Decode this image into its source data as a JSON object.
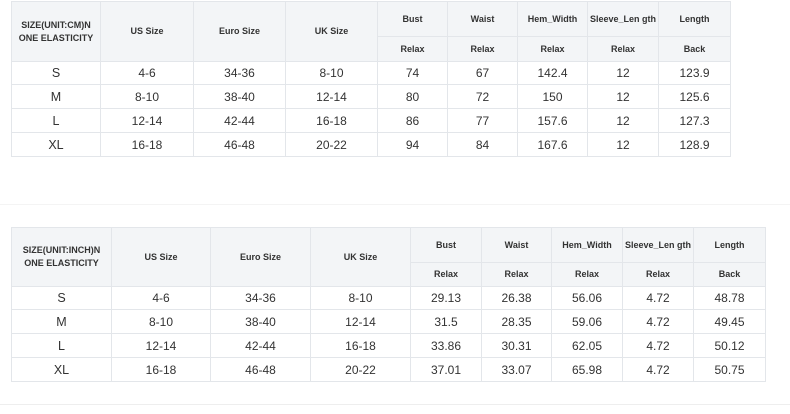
{
  "cm_table": {
    "corner_label": "SIZE(UNIT:CM)N ONE ELASTICITY",
    "headers": [
      "US Size",
      "Euro Size",
      "UK Size",
      "Bust",
      "Waist",
      "Hem_Width",
      "Sleeve_Len gth",
      "Length"
    ],
    "subheaders": [
      "Relax",
      "Relax",
      "Relax",
      "Relax",
      "Back"
    ],
    "rows": [
      [
        "S",
        "4-6",
        "34-36",
        "8-10",
        "74",
        "67",
        "142.4",
        "12",
        "123.9"
      ],
      [
        "M",
        "8-10",
        "38-40",
        "12-14",
        "80",
        "72",
        "150",
        "12",
        "125.6"
      ],
      [
        "L",
        "12-14",
        "42-44",
        "16-18",
        "86",
        "77",
        "157.6",
        "12",
        "127.3"
      ],
      [
        "XL",
        "16-18",
        "46-48",
        "20-22",
        "94",
        "84",
        "167.6",
        "12",
        "128.9"
      ]
    ]
  },
  "inch_table": {
    "corner_label": "SIZE(UNIT:INCH)N ONE ELASTICITY",
    "headers": [
      "US Size",
      "Euro Size",
      "UK Size",
      "Bust",
      "Waist",
      "Hem_Width",
      "Sleeve_Len gth",
      "Length"
    ],
    "subheaders": [
      "Relax",
      "Relax",
      "Relax",
      "Relax",
      "Back"
    ],
    "rows": [
      [
        "S",
        "4-6",
        "34-36",
        "8-10",
        "29.13",
        "26.38",
        "56.06",
        "4.72",
        "48.78"
      ],
      [
        "M",
        "8-10",
        "38-40",
        "12-14",
        "31.5",
        "28.35",
        "59.06",
        "4.72",
        "49.45"
      ],
      [
        "L",
        "12-14",
        "42-44",
        "16-18",
        "33.86",
        "30.31",
        "62.05",
        "4.72",
        "50.12"
      ],
      [
        "XL",
        "16-18",
        "46-48",
        "20-22",
        "37.01",
        "33.07",
        "65.98",
        "4.72",
        "50.75"
      ]
    ]
  }
}
